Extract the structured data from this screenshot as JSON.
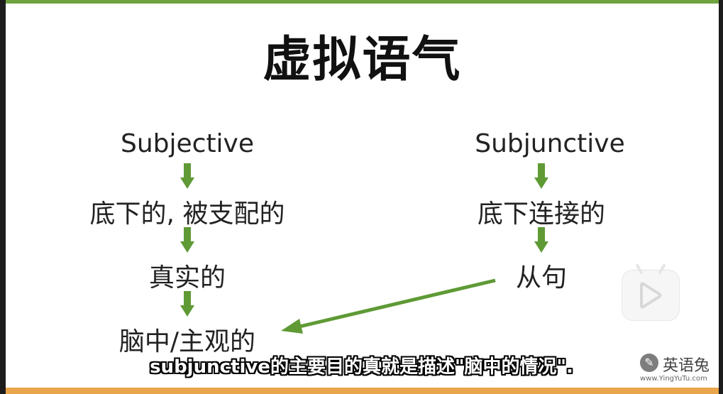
{
  "slide": {
    "title": "虚拟语气",
    "left_column": [
      "Subjective",
      "底下的, 被支配的",
      "真实的",
      "脑中/主观的"
    ],
    "right_column": [
      "Subjunctive",
      "底下连接的",
      "从句"
    ]
  },
  "subtitle": "subjunctive的主要目的真就是描述\"脑中的情况\".",
  "watermark": {
    "name": "英语兔",
    "url": "www.YingYuTu.com",
    "icon": "rabbit-logo-icon"
  },
  "player": {
    "play_icon": "play-icon"
  },
  "colors": {
    "accent_green": "#6ea33f",
    "bottom_orange": "#e9a54b",
    "arrow_green": "#5f9a35"
  }
}
